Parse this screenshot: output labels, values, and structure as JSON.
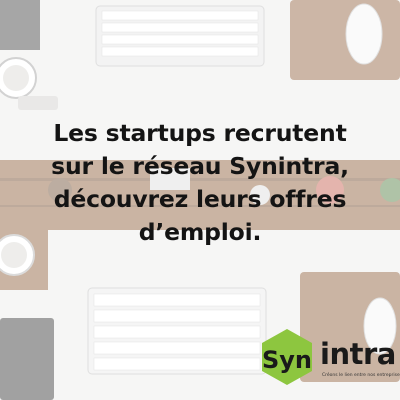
{
  "headline": {
    "line1": "Les startups recrutent",
    "line2": "sur le réseau Synintra,",
    "line3": "découvrez leurs offres",
    "line4": "d’emploi."
  },
  "logo": {
    "mark_text": "Syn",
    "word": "intra",
    "tagline": "Créons le lien entre nos entreprises",
    "color_green": "#8dc63f",
    "color_dark": "#1a1a1a"
  },
  "colors": {
    "desk_wood": "#a0714a",
    "headline_text": "#141414"
  },
  "icons": [
    "keyboard-icon",
    "mouse-icon",
    "coffee-cup-icon",
    "plant-icon"
  ]
}
